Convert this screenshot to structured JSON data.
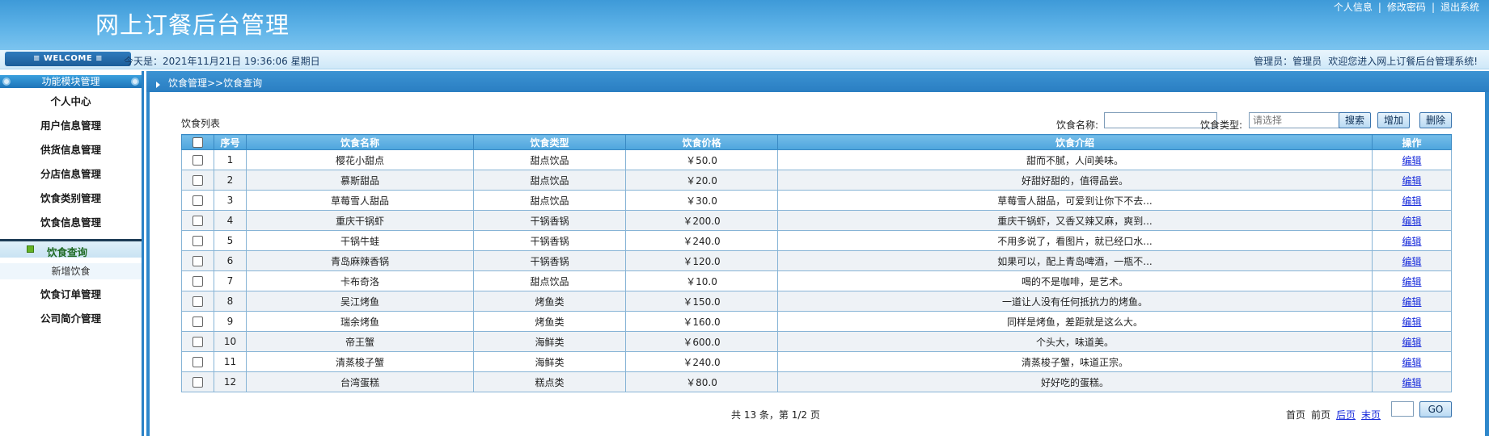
{
  "header": {
    "title": "网上订餐后台管理",
    "links": [
      "个人信息",
      "修改密码",
      "退出系统"
    ],
    "separator": "|"
  },
  "infobar": {
    "welcome": "≡ WELCOME ≡",
    "today": "今天是：2021年11月21日   19:36:06   星期日",
    "admin_label": "管理员：管理员",
    "welcome_msg": "欢迎您进入网上订餐后台管理系统!"
  },
  "sidebar": {
    "header": "功能模块管理",
    "items": [
      "个人中心",
      "用户信息管理",
      "供货信息管理",
      "分店信息管理",
      "饮食类别管理",
      "饮食信息管理"
    ],
    "active_sub": "饮食查询",
    "sub_item": "新增饮食",
    "items_after": [
      "饮食订单管理",
      "公司简介管理"
    ]
  },
  "main": {
    "breadcrumb": "饮食管理>>饮食查询",
    "list_label": "饮食列表",
    "search": {
      "name_label": "饮食名称:",
      "name_value": "",
      "type_label": "饮食类型:",
      "type_selected": "请选择",
      "search_btn": "搜索",
      "add_btn": "增加",
      "delete_btn": "删除"
    },
    "table": {
      "columns": [
        "",
        "序号",
        "饮食名称",
        "饮食类型",
        "饮食价格",
        "饮食介绍",
        "操作"
      ],
      "edit_label": "编辑",
      "rows": [
        {
          "no": "1",
          "name": "樱花小甜点",
          "type": "甜点饮品",
          "price": "￥50.0",
          "desc": "甜而不腻，人间美味。"
        },
        {
          "no": "2",
          "name": "慕斯甜品",
          "type": "甜点饮品",
          "price": "￥20.0",
          "desc": "好甜好甜的，值得品尝。"
        },
        {
          "no": "3",
          "name": "草莓雪人甜品",
          "type": "甜点饮品",
          "price": "￥30.0",
          "desc": "草莓雪人甜品，可爱到让你下不去..."
        },
        {
          "no": "4",
          "name": "重庆干锅虾",
          "type": "干锅香锅",
          "price": "￥200.0",
          "desc": "重庆干锅虾，又香又辣又麻，爽到..."
        },
        {
          "no": "5",
          "name": "干锅牛蛙",
          "type": "干锅香锅",
          "price": "￥240.0",
          "desc": "不用多说了，看图片，就已经口水..."
        },
        {
          "no": "6",
          "name": "青岛麻辣香锅",
          "type": "干锅香锅",
          "price": "￥120.0",
          "desc": "如果可以，配上青岛啤酒，一瓶不..."
        },
        {
          "no": "7",
          "name": "卡布奇洛",
          "type": "甜点饮品",
          "price": "￥10.0",
          "desc": "喝的不是咖啡，是艺术。"
        },
        {
          "no": "8",
          "name": "吴江烤鱼",
          "type": "烤鱼类",
          "price": "￥150.0",
          "desc": "一道让人没有任何抵抗力的烤鱼。"
        },
        {
          "no": "9",
          "name": "瑞余烤鱼",
          "type": "烤鱼类",
          "price": "￥160.0",
          "desc": "同样是烤鱼，差距就是这么大。"
        },
        {
          "no": "10",
          "name": "帝王蟹",
          "type": "海鲜类",
          "price": "￥600.0",
          "desc": "个头大，味道美。"
        },
        {
          "no": "11",
          "name": "清蒸梭子蟹",
          "type": "海鲜类",
          "price": "￥240.0",
          "desc": "清蒸梭子蟹，味道正宗。"
        },
        {
          "no": "12",
          "name": "台湾蛋糕",
          "type": "糕点类",
          "price": "￥80.0",
          "desc": "好好吃的蛋糕。"
        }
      ]
    },
    "pager": {
      "total": "共 13 条，第 1/2 页",
      "first": "首页",
      "prev": "前页",
      "next": "后页",
      "last": "末页",
      "page_input": "",
      "go": "GO"
    }
  },
  "colors": {
    "header_blue": "#4aa6e0",
    "main_blue": "#2f88cb",
    "table_header": "#5eafe3",
    "link": "#1a2ddb",
    "active_green": "#65b324"
  }
}
